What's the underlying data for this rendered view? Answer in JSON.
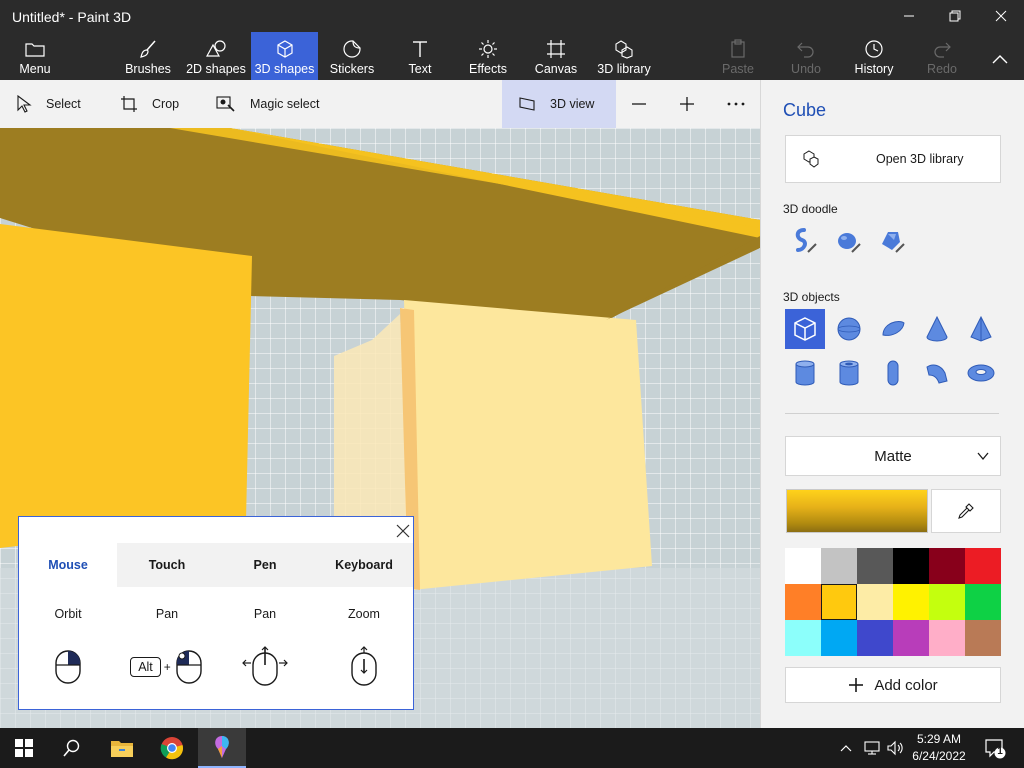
{
  "window": {
    "title": "Untitled* - Paint 3D"
  },
  "ribbon": {
    "menu": "Menu",
    "brushes": "Brushes",
    "shapes2d": "2D shapes",
    "shapes3d": "3D shapes",
    "stickers": "Stickers",
    "text": "Text",
    "effects": "Effects",
    "canvas": "Canvas",
    "library3d": "3D library",
    "paste": "Paste",
    "undo": "Undo",
    "history": "History",
    "redo": "Redo"
  },
  "toolbar": {
    "select": "Select",
    "crop": "Crop",
    "magic_select": "Magic select",
    "view3d": "3D view"
  },
  "panel": {
    "title": "Cube",
    "open_library": "Open 3D library",
    "doodle_label": "3D doodle",
    "objects_label": "3D objects",
    "material": "Matte",
    "add_color": "Add color",
    "accent_color": "#3b63d8",
    "swatches": [
      "#ffffff",
      "#c3c3c3",
      "#585858",
      "#000000",
      "#88001b",
      "#ec1c24",
      "#ff7f27",
      "#ffc90e",
      "#fdeca6",
      "#fff200",
      "#c4ff0e",
      "#0ed145",
      "#8cfffb",
      "#00a8f3",
      "#3f48cc",
      "#b83dba",
      "#ffaec8",
      "#b97a56"
    ]
  },
  "help_popup": {
    "tabs": [
      "Mouse",
      "Touch",
      "Pen",
      "Keyboard"
    ],
    "actions": [
      "Orbit",
      "Pan",
      "Pan",
      "Zoom"
    ],
    "alt_key": "Alt",
    "plus": "+"
  },
  "taskbar": {
    "time": "5:29 AM",
    "date": "6/24/2022",
    "notifications": "1"
  }
}
